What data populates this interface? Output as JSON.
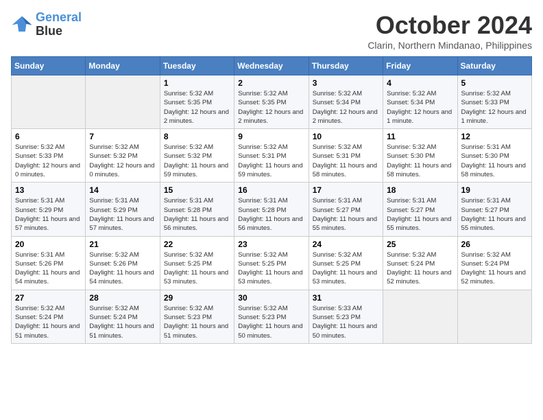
{
  "header": {
    "logo_line1": "General",
    "logo_line2": "Blue",
    "month": "October 2024",
    "location": "Clarin, Northern Mindanao, Philippines"
  },
  "days_of_week": [
    "Sunday",
    "Monday",
    "Tuesday",
    "Wednesday",
    "Thursday",
    "Friday",
    "Saturday"
  ],
  "weeks": [
    [
      {
        "day": "",
        "info": ""
      },
      {
        "day": "",
        "info": ""
      },
      {
        "day": "1",
        "info": "Sunrise: 5:32 AM\nSunset: 5:35 PM\nDaylight: 12 hours and 2 minutes."
      },
      {
        "day": "2",
        "info": "Sunrise: 5:32 AM\nSunset: 5:35 PM\nDaylight: 12 hours and 2 minutes."
      },
      {
        "day": "3",
        "info": "Sunrise: 5:32 AM\nSunset: 5:34 PM\nDaylight: 12 hours and 2 minutes."
      },
      {
        "day": "4",
        "info": "Sunrise: 5:32 AM\nSunset: 5:34 PM\nDaylight: 12 hours and 1 minute."
      },
      {
        "day": "5",
        "info": "Sunrise: 5:32 AM\nSunset: 5:33 PM\nDaylight: 12 hours and 1 minute."
      }
    ],
    [
      {
        "day": "6",
        "info": "Sunrise: 5:32 AM\nSunset: 5:33 PM\nDaylight: 12 hours and 0 minutes."
      },
      {
        "day": "7",
        "info": "Sunrise: 5:32 AM\nSunset: 5:32 PM\nDaylight: 12 hours and 0 minutes."
      },
      {
        "day": "8",
        "info": "Sunrise: 5:32 AM\nSunset: 5:32 PM\nDaylight: 11 hours and 59 minutes."
      },
      {
        "day": "9",
        "info": "Sunrise: 5:32 AM\nSunset: 5:31 PM\nDaylight: 11 hours and 59 minutes."
      },
      {
        "day": "10",
        "info": "Sunrise: 5:32 AM\nSunset: 5:31 PM\nDaylight: 11 hours and 58 minutes."
      },
      {
        "day": "11",
        "info": "Sunrise: 5:32 AM\nSunset: 5:30 PM\nDaylight: 11 hours and 58 minutes."
      },
      {
        "day": "12",
        "info": "Sunrise: 5:31 AM\nSunset: 5:30 PM\nDaylight: 11 hours and 58 minutes."
      }
    ],
    [
      {
        "day": "13",
        "info": "Sunrise: 5:31 AM\nSunset: 5:29 PM\nDaylight: 11 hours and 57 minutes."
      },
      {
        "day": "14",
        "info": "Sunrise: 5:31 AM\nSunset: 5:29 PM\nDaylight: 11 hours and 57 minutes."
      },
      {
        "day": "15",
        "info": "Sunrise: 5:31 AM\nSunset: 5:28 PM\nDaylight: 11 hours and 56 minutes."
      },
      {
        "day": "16",
        "info": "Sunrise: 5:31 AM\nSunset: 5:28 PM\nDaylight: 11 hours and 56 minutes."
      },
      {
        "day": "17",
        "info": "Sunrise: 5:31 AM\nSunset: 5:27 PM\nDaylight: 11 hours and 55 minutes."
      },
      {
        "day": "18",
        "info": "Sunrise: 5:31 AM\nSunset: 5:27 PM\nDaylight: 11 hours and 55 minutes."
      },
      {
        "day": "19",
        "info": "Sunrise: 5:31 AM\nSunset: 5:27 PM\nDaylight: 11 hours and 55 minutes."
      }
    ],
    [
      {
        "day": "20",
        "info": "Sunrise: 5:31 AM\nSunset: 5:26 PM\nDaylight: 11 hours and 54 minutes."
      },
      {
        "day": "21",
        "info": "Sunrise: 5:32 AM\nSunset: 5:26 PM\nDaylight: 11 hours and 54 minutes."
      },
      {
        "day": "22",
        "info": "Sunrise: 5:32 AM\nSunset: 5:25 PM\nDaylight: 11 hours and 53 minutes."
      },
      {
        "day": "23",
        "info": "Sunrise: 5:32 AM\nSunset: 5:25 PM\nDaylight: 11 hours and 53 minutes."
      },
      {
        "day": "24",
        "info": "Sunrise: 5:32 AM\nSunset: 5:25 PM\nDaylight: 11 hours and 53 minutes."
      },
      {
        "day": "25",
        "info": "Sunrise: 5:32 AM\nSunset: 5:24 PM\nDaylight: 11 hours and 52 minutes."
      },
      {
        "day": "26",
        "info": "Sunrise: 5:32 AM\nSunset: 5:24 PM\nDaylight: 11 hours and 52 minutes."
      }
    ],
    [
      {
        "day": "27",
        "info": "Sunrise: 5:32 AM\nSunset: 5:24 PM\nDaylight: 11 hours and 51 minutes."
      },
      {
        "day": "28",
        "info": "Sunrise: 5:32 AM\nSunset: 5:24 PM\nDaylight: 11 hours and 51 minutes."
      },
      {
        "day": "29",
        "info": "Sunrise: 5:32 AM\nSunset: 5:23 PM\nDaylight: 11 hours and 51 minutes."
      },
      {
        "day": "30",
        "info": "Sunrise: 5:32 AM\nSunset: 5:23 PM\nDaylight: 11 hours and 50 minutes."
      },
      {
        "day": "31",
        "info": "Sunrise: 5:33 AM\nSunset: 5:23 PM\nDaylight: 11 hours and 50 minutes."
      },
      {
        "day": "",
        "info": ""
      },
      {
        "day": "",
        "info": ""
      }
    ]
  ]
}
